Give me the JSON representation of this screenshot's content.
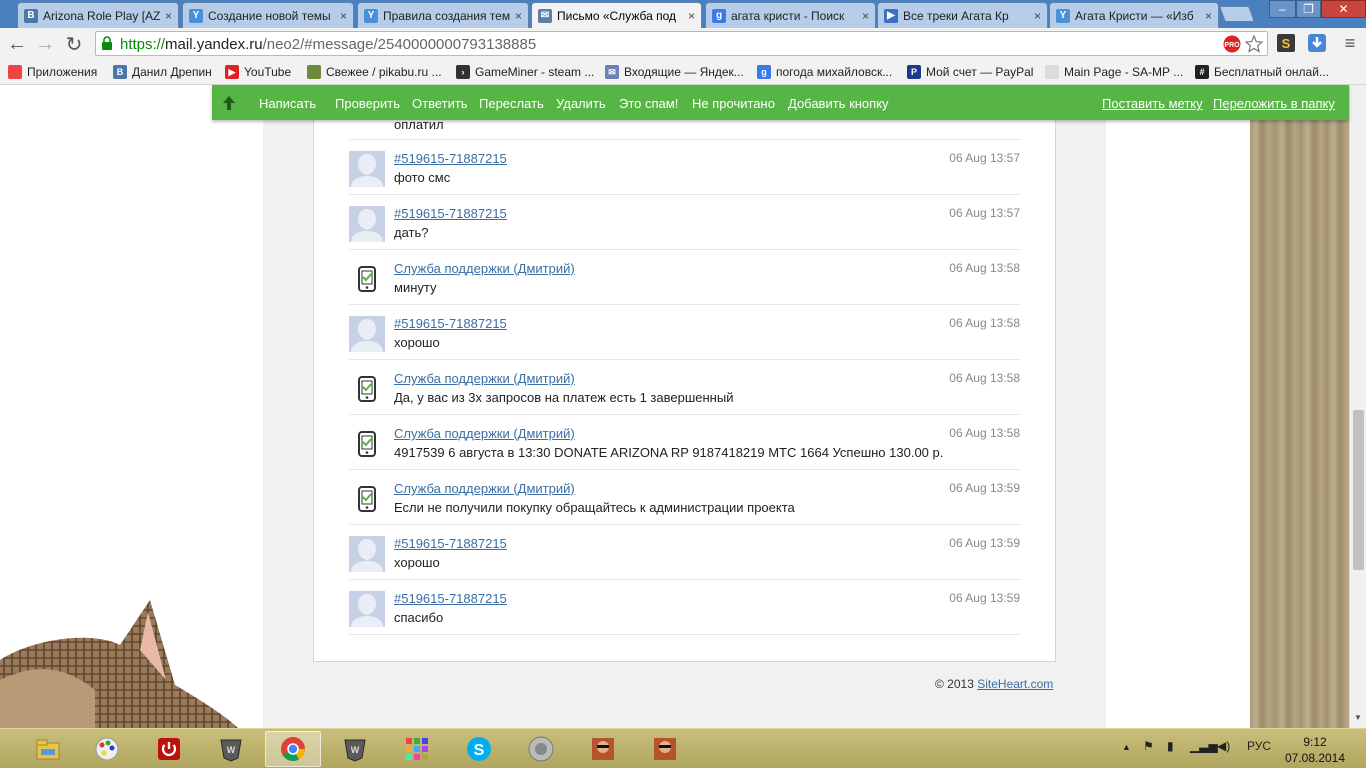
{
  "tabs": [
    {
      "title": "Arizona Role Play [AZ-",
      "favicon": "vk-icon",
      "active": false
    },
    {
      "title": "Создание новой темы",
      "favicon": "yandex-mail-icon",
      "active": false
    },
    {
      "title": "Правила создания тем",
      "favicon": "yandex-mail-icon",
      "active": false
    },
    {
      "title": "Письмо «Служба под",
      "favicon": "envelope-icon",
      "active": true
    },
    {
      "title": "агата кристи - Поиск",
      "favicon": "google-icon",
      "active": false
    },
    {
      "title": "Все треки Агата Кр",
      "favicon": "play-icon",
      "active": false
    },
    {
      "title": "Агата Кристи — «Изб",
      "favicon": "yandex-mail-icon",
      "active": false
    }
  ],
  "tab_close": "×",
  "window": {
    "minimize": "–",
    "restore": "❐",
    "close": "✕"
  },
  "address": {
    "scheme": "https://",
    "host": "mail.yandex.ru",
    "path": "/neo2/#message/2540000000793138885"
  },
  "bookmarks": [
    {
      "label": "Приложения",
      "icon": "apps-grid-icon",
      "icon_text": ""
    },
    {
      "label": "Данил Дрепин",
      "icon": "vk-icon",
      "icon_text": "B"
    },
    {
      "label": "YouTube",
      "icon": "youtube-icon",
      "icon_text": "▶"
    },
    {
      "label": "Свежее / pikabu.ru ...",
      "icon": "pikabu-icon",
      "icon_text": ""
    },
    {
      "label": "GameMiner - steam ...",
      "icon": "gameminer-icon",
      "icon_text": "›"
    },
    {
      "label": "Входящие — Яндек...",
      "icon": "mail-icon",
      "icon_text": "✉"
    },
    {
      "label": "погода михайловск...",
      "icon": "google-icon",
      "icon_text": "g"
    },
    {
      "label": "Мой счет — PayPal",
      "icon": "paypal-icon",
      "icon_text": "P"
    },
    {
      "label": "Main Page - SA-MP ...",
      "icon": "page-icon",
      "icon_text": ""
    },
    {
      "label": "Бесплатный онлай...",
      "icon": "hash-icon",
      "icon_text": "#"
    }
  ],
  "mailbar": {
    "actions": [
      "Написать",
      "Проверить",
      "Ответить",
      "Переслать",
      "Удалить",
      "Это спам!",
      "Не прочитано",
      "Добавить кнопку"
    ],
    "right_actions": [
      "Поставить метку",
      "Переложить в папку"
    ]
  },
  "partial_message_text": "оплатил",
  "messages": [
    {
      "author": "#519615-71887215",
      "text": "фото смс",
      "time": "06 Aug 13:57",
      "kind": "user"
    },
    {
      "author": "#519615-71887215",
      "text": "дать?",
      "time": "06 Aug 13:57",
      "kind": "user"
    },
    {
      "author": "Служба поддержки (Дмитрий)",
      "text": "минуту",
      "time": "06 Aug 13:58",
      "kind": "support"
    },
    {
      "author": "#519615-71887215",
      "text": "хорошо",
      "time": "06 Aug 13:58",
      "kind": "user"
    },
    {
      "author": "Служба поддержки (Дмитрий)",
      "text": "Да, у вас из 3х запросов на платеж есть 1 завершенный",
      "time": "06 Aug 13:58",
      "kind": "support"
    },
    {
      "author": "Служба поддержки (Дмитрий)",
      "text": "4917539 6 августа в 13:30 DONATE ARIZONA RP 9187418219 МТС 1664 Успешно 130.00 р.",
      "time": "06 Aug 13:58",
      "kind": "support"
    },
    {
      "author": "Служба поддержки (Дмитрий)",
      "text": "Если не получили покупку обращайтесь к администрации проекта",
      "time": "06 Aug 13:59",
      "kind": "support"
    },
    {
      "author": "#519615-71887215",
      "text": "хорошо",
      "time": "06 Aug 13:59",
      "kind": "user"
    },
    {
      "author": "#519615-71887215",
      "text": "спасибо",
      "time": "06 Aug 13:59",
      "kind": "user"
    }
  ],
  "footer": {
    "copyright": "© 2013 ",
    "link": "SiteHeart.com"
  },
  "taskbar": {
    "apps": [
      "file-explorer-icon",
      "paint-icon",
      "power-icon",
      "world-of-tanks-icon",
      "chrome-icon",
      "world-of-tanks-icon",
      "apps-icon",
      "skype-icon",
      "speaker-app-icon",
      "gta-sa-icon",
      "gta-sa-icon"
    ],
    "language": "РУС",
    "time": "9:12",
    "date": "07.08.2014"
  },
  "colors": {
    "mailbar_green": "#57b545",
    "link_blue": "#3a6ea5",
    "tabstrip": "#4a7fc0"
  }
}
